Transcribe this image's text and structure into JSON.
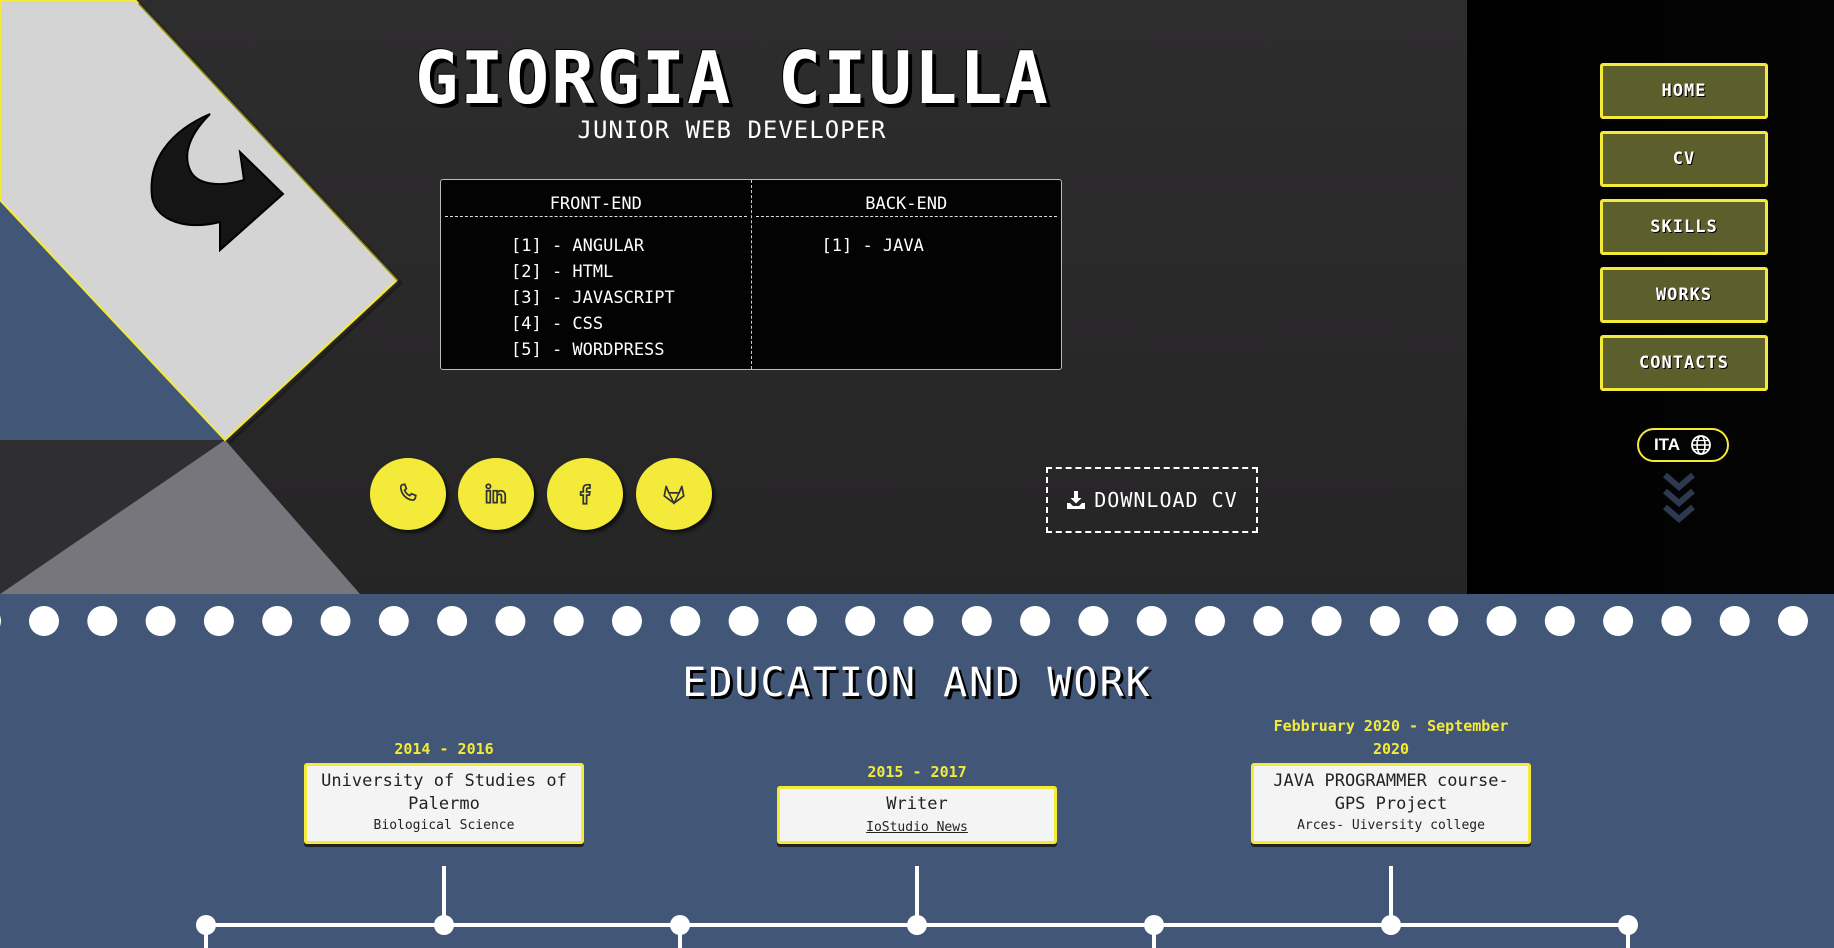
{
  "header": {
    "name": "GIORGIA CIULLA",
    "role": "JUNIOR WEB DEVELOPER"
  },
  "skills": {
    "frontend_title": "FRONT-END",
    "frontend": [
      "[1] - ANGULAR",
      "[2] - HTML",
      "[3] - JAVASCRIPT",
      "[4] - CSS",
      "[5] - WORDPRESS"
    ],
    "backend_title": "BACK-END",
    "backend": [
      "[1] - JAVA"
    ]
  },
  "social": {
    "icons": [
      "phone-icon",
      "linkedin-icon",
      "facebook-icon",
      "gitlab-icon"
    ]
  },
  "download": {
    "label": "DOWNLOAD CV",
    "icon": "download-icon"
  },
  "nav": {
    "items": [
      "HOME",
      "CV",
      "SKILLS",
      "WORKS",
      "CONTACTS"
    ]
  },
  "language": {
    "label": "ITA",
    "icon": "globe-icon"
  },
  "education": {
    "title": "EDUCATION AND WORK",
    "entries": [
      {
        "date": "2014 - 2016",
        "title": "University of Studies of Palermo",
        "subtitle": "Biological Science"
      },
      {
        "date": "2015 - 2017",
        "title": "Writer",
        "subtitle": "IoStudio News"
      },
      {
        "date_line1": "Febbruary 2020 - September",
        "date_line2": "2020",
        "title": "JAVA PROGRAMMER course- GPS Project",
        "subtitle": "Arces- Uiversity college"
      }
    ]
  },
  "colors": {
    "accent_yellow": "#f4ea3a",
    "nav_olive": "#5c5e2c",
    "section_blue": "#425778",
    "dark_bg": "#2a2a2a"
  }
}
